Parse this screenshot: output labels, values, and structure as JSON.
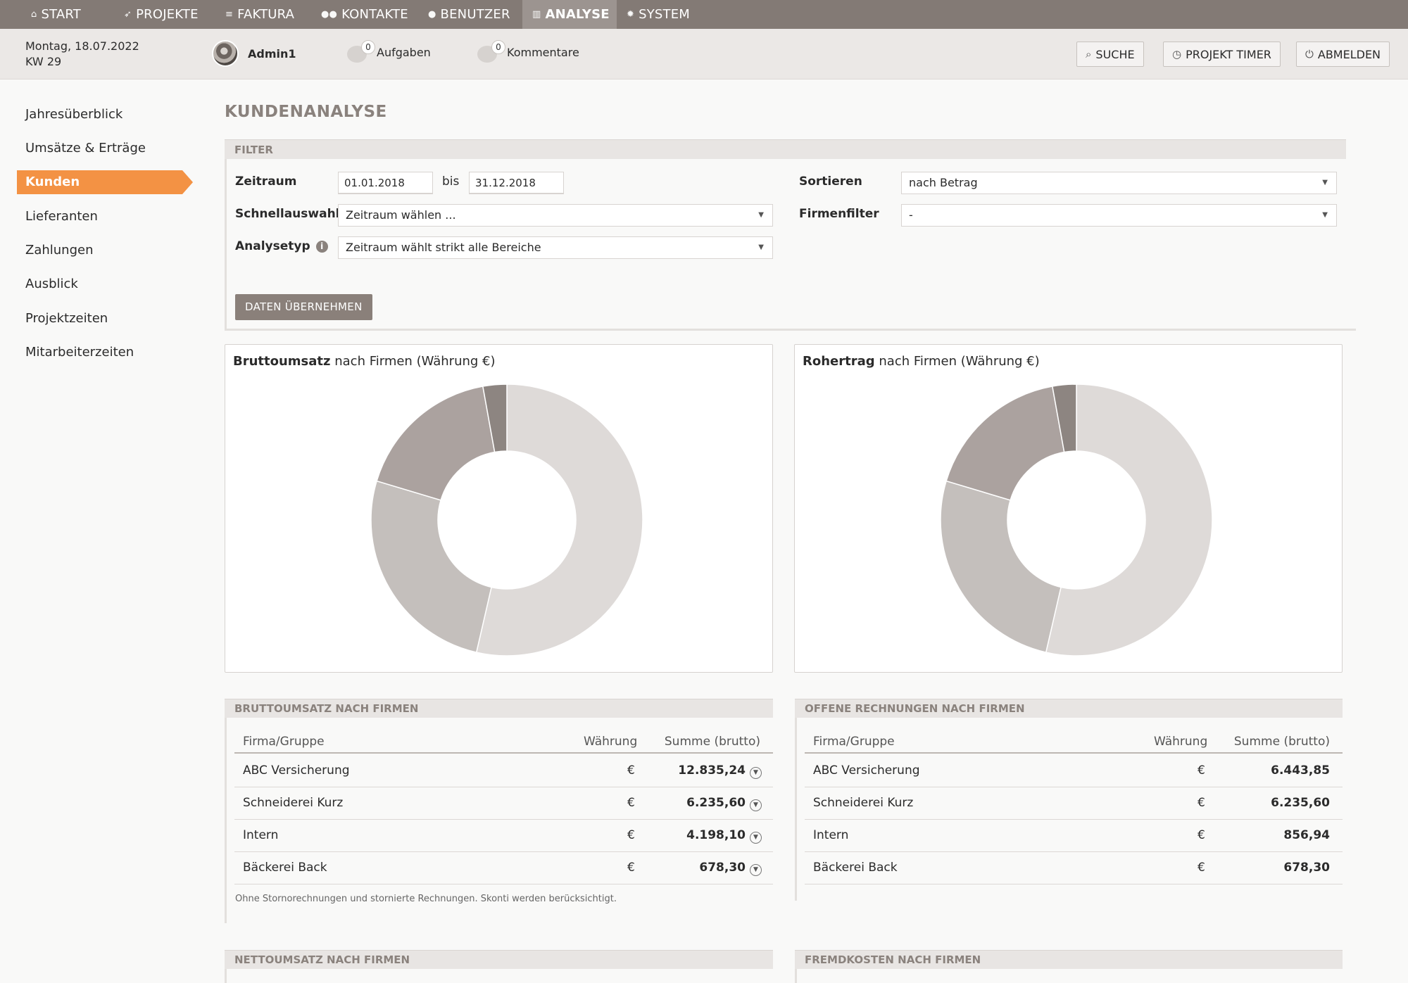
{
  "nav": {
    "items": [
      {
        "label": "START",
        "icon": "home-icon"
      },
      {
        "label": "PROJEKTE",
        "icon": "rocket-icon"
      },
      {
        "label": "FAKTURA",
        "icon": "invoice-icon"
      },
      {
        "label": "KONTAKTE",
        "icon": "users-icon"
      },
      {
        "label": "BENUTZER",
        "icon": "user-icon"
      },
      {
        "label": "ANALYSE",
        "icon": "chart-icon",
        "active": true
      },
      {
        "label": "SYSTEM",
        "icon": "gear-icon"
      }
    ]
  },
  "header": {
    "date_line": "Montag, 18.07.2022",
    "week_line": "KW 29",
    "user_name": "Admin1",
    "tasks": {
      "count": "0",
      "label": "Aufgaben"
    },
    "comments": {
      "count": "0",
      "label": "Kommentare"
    },
    "search_label": "SUCHE",
    "timer_label": "PROJEKT TIMER",
    "logout_label": "ABMELDEN"
  },
  "sidebar": {
    "items": [
      {
        "label": "Jahresüberblick"
      },
      {
        "label": "Umsätze & Erträge"
      },
      {
        "label": "Kunden",
        "active": true
      },
      {
        "label": "Lieferanten"
      },
      {
        "label": "Zahlungen"
      },
      {
        "label": "Ausblick"
      },
      {
        "label": "Projektzeiten"
      },
      {
        "label": "Mitarbeiterzeiten"
      }
    ]
  },
  "page": {
    "title": "KUNDENANALYSE"
  },
  "filter": {
    "section_label": "FILTER",
    "zeitraum_label": "Zeitraum",
    "date_from": "01.01.2018",
    "bis_label": "bis",
    "date_to": "31.12.2018",
    "schnellauswahl_label": "Schnellauswahl",
    "schnellauswahl_value": "Zeitraum wählen ...",
    "analysetyp_label": "Analysetyp",
    "analysetyp_value": "Zeitraum wählt strikt alle Bereiche",
    "sortieren_label": "Sortieren",
    "sortieren_value": "nach Betrag",
    "firmenfilter_label": "Firmenfilter",
    "firmenfilter_value": "-",
    "apply_label": "DATEN ÜBERNEHMEN"
  },
  "chart_data": [
    {
      "type": "pie",
      "title_bold": "Bruttoumsatz",
      "title_rest": "nach Firmen (Währung €)",
      "categories": [
        "ABC Versicherung",
        "Schneiderei Kurz",
        "Intern",
        "Bäckerei Back"
      ],
      "values": [
        12835.24,
        6235.6,
        4198.1,
        678.3
      ],
      "colors": [
        "#dedad8",
        "#c4bfbc",
        "#aba29f",
        "#8d8581"
      ]
    },
    {
      "type": "pie",
      "title_bold": "Rohertrag",
      "title_rest": "nach Firmen (Währung €)",
      "categories": [
        "ABC Versicherung",
        "Schneiderei Kurz",
        "Intern",
        "Bäckerei Back"
      ],
      "values": [
        12835.24,
        6235.6,
        4198.1,
        678.3
      ],
      "colors": [
        "#dedad8",
        "#c4bfbc",
        "#aba29f",
        "#8d8581"
      ]
    }
  ],
  "brutto_table": {
    "section_label": "BRUTTOUMSATZ NACH FIRMEN",
    "headers": {
      "firma": "Firma/Gruppe",
      "currency": "Währung",
      "sum": "Summe (brutto)"
    },
    "rows": [
      {
        "firma": "ABC Versicherung",
        "currency": "€",
        "sum": "12.835,24"
      },
      {
        "firma": "Schneiderei Kurz",
        "currency": "€",
        "sum": "6.235,60"
      },
      {
        "firma": "Intern",
        "currency": "€",
        "sum": "4.198,10"
      },
      {
        "firma": "Bäckerei Back",
        "currency": "€",
        "sum": "678,30"
      }
    ],
    "note": "Ohne Stornorechnungen und stornierte Rechnungen. Skonti werden berücksichtigt."
  },
  "offene_table": {
    "section_label": "OFFENE RECHNUNGEN NACH FIRMEN",
    "headers": {
      "firma": "Firma/Gruppe",
      "currency": "Währung",
      "sum": "Summe (brutto)"
    },
    "rows": [
      {
        "firma": "ABC Versicherung",
        "currency": "€",
        "sum": "6.443,85"
      },
      {
        "firma": "Schneiderei Kurz",
        "currency": "€",
        "sum": "6.235,60"
      },
      {
        "firma": "Intern",
        "currency": "€",
        "sum": "856,94"
      },
      {
        "firma": "Bäckerei Back",
        "currency": "€",
        "sum": "678,30"
      }
    ]
  },
  "netto_section_label": "NETTOUMSATZ NACH FIRMEN",
  "fremd_section_label": "FREMDKOSTEN NACH FIRMEN"
}
